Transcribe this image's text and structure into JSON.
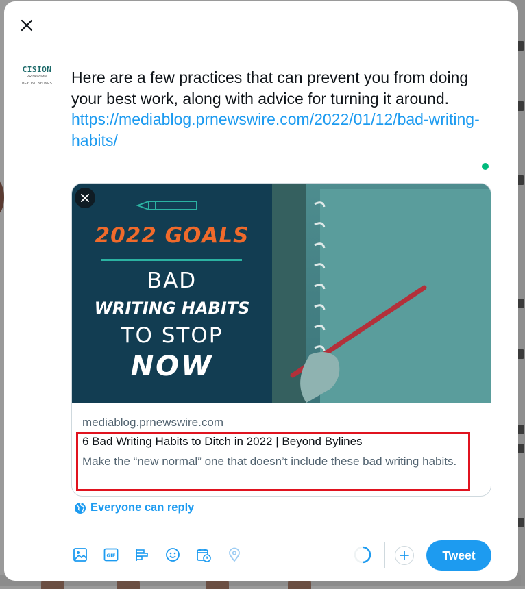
{
  "modal": {
    "close_icon": "close-icon"
  },
  "account": {
    "avatar_line1": "CISION",
    "avatar_line2": "PR Newswire",
    "avatar_line3": "BEYOND BYLINES"
  },
  "tweet": {
    "text": "Here are a few practices that can prevent you from doing your best work, along with advice for turning it around.",
    "link": "https://mediablog.prnewswire.com/2022/01/12/bad-writing-habits/"
  },
  "link_card": {
    "image": {
      "line_goals": "2022 GOALS",
      "line_bad": "BAD",
      "line_habits": "WRITING HABITS",
      "line_tostop": "TO STOP",
      "line_now": "NOW"
    },
    "domain": "mediablog.prnewswire.com",
    "title": "6 Bad Writing Habits to Ditch in 2022 | Beyond Bylines",
    "description": "Make the “new normal” one that doesn’t include these bad writing habits."
  },
  "reply_setting": {
    "label": "Everyone can reply",
    "icon": "globe-icon"
  },
  "toolbar": {
    "icons": [
      "image-icon",
      "gif-icon",
      "poll-icon",
      "emoji-icon",
      "schedule-icon",
      "location-icon"
    ],
    "tweet_label": "Tweet"
  },
  "colors": {
    "accent": "#1d9bf0",
    "text": "#0f1419",
    "secondary_text": "#536471",
    "highlight": "#e0131f",
    "online_dot": "#00ba7c"
  }
}
